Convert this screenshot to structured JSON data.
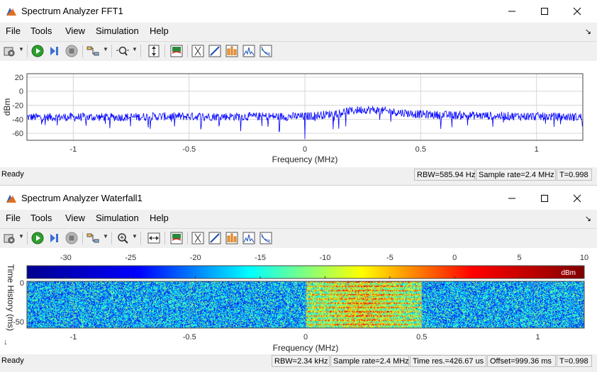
{
  "window1": {
    "title": "Spectrum Analyzer FFT1",
    "menu": [
      "File",
      "Tools",
      "View",
      "Simulation",
      "Help"
    ],
    "status": {
      "ready": "Ready",
      "rbw": "RBW=585.94 Hz",
      "sample_rate": "Sample rate=2.4 MHz",
      "time": "T=0.998"
    }
  },
  "window2": {
    "title": "Spectrum Analyzer Waterfall1",
    "menu": [
      "File",
      "Tools",
      "View",
      "Simulation",
      "Help"
    ],
    "status": {
      "ready": "Ready",
      "rbw": "RBW=2.34 kHz",
      "sample_rate": "Sample rate=2.4 MHz",
      "time_res": "Time res.=426.67 us",
      "offset": "Offset=999.36 ms",
      "time": "T=0.998"
    }
  },
  "chart_data": [
    {
      "type": "line",
      "xlabel": "Frequency (MHz)",
      "ylabel": "dBm",
      "xlim": [
        -1.2,
        1.2
      ],
      "ylim": [
        -70,
        25
      ],
      "xticks": [
        "-1",
        "-0.5",
        "0",
        "0.5",
        "1"
      ],
      "yticks": [
        "20",
        "0",
        "-20",
        "-40",
        "-60"
      ],
      "grid": true,
      "line_color": "#0000ff",
      "series": [
        {
          "x": [
            -1.2,
            -1.0,
            -0.8,
            -0.6,
            -0.4,
            -0.2,
            0.0,
            0.1,
            0.2,
            0.25,
            0.3,
            0.4,
            0.5,
            0.6,
            0.8,
            1.0,
            1.2
          ],
          "values": [
            -37,
            -37,
            -37,
            -36,
            -36,
            -36,
            -36,
            -33,
            -28,
            -26,
            -27,
            -30,
            -33,
            -34,
            -35,
            -36,
            -37
          ],
          "noise_amplitude_db": 6,
          "dip": {
            "x": 0.0,
            "value": -68
          }
        }
      ]
    },
    {
      "type": "heatmap",
      "xlabel": "Frequency (MHz)",
      "ylabel": "Time History (ms)",
      "xticks": [
        "-1",
        "-0.5",
        "0",
        "0.5",
        "1"
      ],
      "yticks": [
        "0",
        "-50"
      ],
      "colorbar": {
        "label": "dBm",
        "ticks": [
          "-30",
          "-25",
          "-20",
          "-15",
          "-10",
          "-5",
          "0",
          "5",
          "10"
        ],
        "range": [
          -33,
          10
        ],
        "colormap": [
          "#00008f",
          "#0000ff",
          "#00ffff",
          "#ffff00",
          "#ff0000",
          "#800000"
        ]
      },
      "background_level_dbm": -18,
      "signal_band_mhz": [
        0.0,
        0.5
      ],
      "signal_level_dbm": -8
    }
  ]
}
